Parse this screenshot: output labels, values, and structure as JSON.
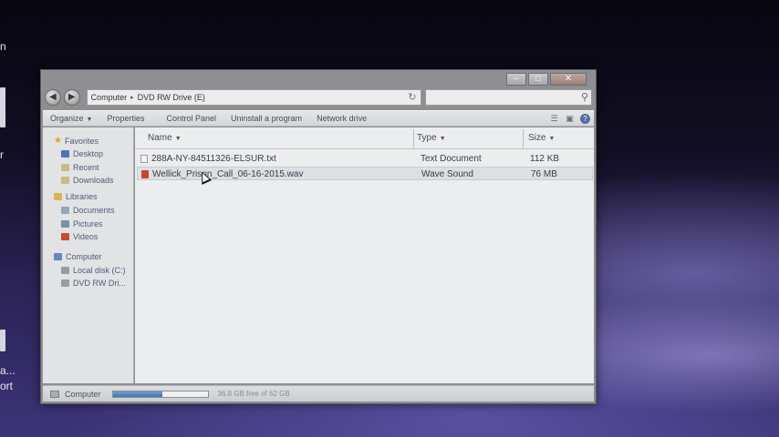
{
  "window": {
    "caption": {
      "minimize": "–",
      "maximize": "□",
      "close": "✕"
    }
  },
  "address": {
    "segments": [
      "Computer",
      "DVD RW Drive (E)"
    ],
    "separator": "▸"
  },
  "toolbar": {
    "organize": "Organize",
    "properties": "Properties",
    "control_panel": "Control Panel",
    "uninstall": "Uninstall a program",
    "network_drive": "Network drive"
  },
  "nav": {
    "favorites": "Favorites",
    "desktop": "Desktop",
    "recent": "Recent",
    "downloads": "Downloads",
    "libraries": "Libraries",
    "documents": "Documents",
    "pictures": "Pictures",
    "videos": "Videos",
    "computer": "Computer",
    "local_disk": "Local disk (C:)",
    "dvd_drive": "DVD RW Dri..."
  },
  "columns": {
    "name": "Name",
    "type": "Type",
    "size": "Size"
  },
  "files": [
    {
      "name": "288A-NY-84511326-ELSUR.txt",
      "type": "Text Document",
      "size": "112 KB"
    },
    {
      "name": "Wellick_Prison_Call_06-16-2015.wav",
      "type": "Wave Sound",
      "size": "76 MB"
    }
  ],
  "status": {
    "location": "Computer",
    "free_space": "36.8 GB free of 62 GB",
    "usage_fraction": 0.52
  },
  "desktop_fragments": [
    "n",
    "r",
    "a...",
    "ort"
  ],
  "colors": {
    "accent": "#3e74ab",
    "selection": "#dcdfe3"
  }
}
